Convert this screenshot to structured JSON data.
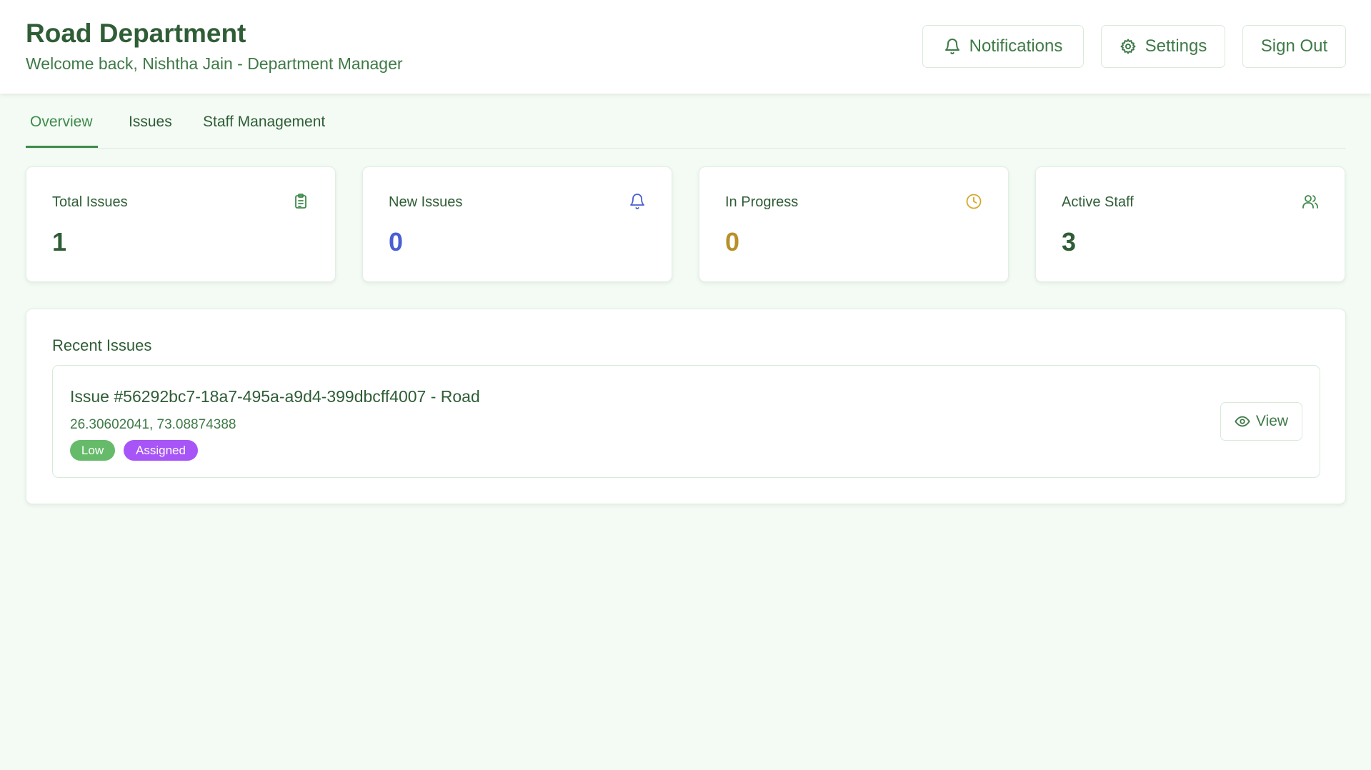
{
  "header": {
    "title": "Road Department",
    "welcome": "Welcome back, Nishtha Jain - Department Manager",
    "buttons": {
      "notifications": "Notifications",
      "settings": "Settings",
      "sign_out": "Sign Out"
    }
  },
  "tabs": [
    {
      "label": "Overview",
      "active": true
    },
    {
      "label": "Issues",
      "active": false
    },
    {
      "label": "Staff Management",
      "active": false
    }
  ],
  "stats": [
    {
      "label": "Total Issues",
      "value": "1",
      "icon": "clipboard-icon",
      "color": "#2f5d36"
    },
    {
      "label": "New Issues",
      "value": "0",
      "icon": "bell-icon",
      "color": "#4a5fd1"
    },
    {
      "label": "In Progress",
      "value": "0",
      "icon": "clock-icon",
      "color": "#b8902a"
    },
    {
      "label": "Active Staff",
      "value": "3",
      "icon": "users-icon",
      "color": "#2f5d36"
    }
  ],
  "recent": {
    "title": "Recent Issues",
    "items": [
      {
        "title": "Issue #56292bc7-18a7-495a-a9d4-399dbcff4007 - Road",
        "coords": "26.30602041, 73.08874388",
        "priority": "Low",
        "status": "Assigned",
        "view_label": "View"
      }
    ]
  },
  "colors": {
    "accent": "#3f8a4a",
    "background": "#f3fbf4",
    "priority_low": "#66bb6a",
    "status_assigned": "#a855f7"
  }
}
